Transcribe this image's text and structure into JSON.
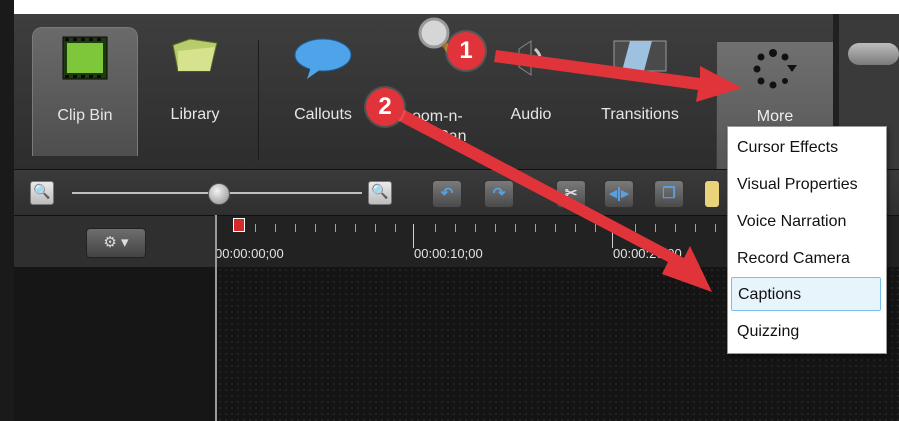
{
  "toolbar": {
    "tabs": [
      {
        "label": "Clip Bin",
        "icon": "film-strip-icon"
      },
      {
        "label": "Library",
        "icon": "folder-icon"
      },
      {
        "label": "Callouts",
        "icon": "speech-bubble-icon"
      },
      {
        "label": "Zoom-n-Pan",
        "icon": "magnifier-icon"
      },
      {
        "label": "Audio",
        "icon": "speaker-icon"
      },
      {
        "label": "Transitions",
        "icon": "transition-icon"
      }
    ],
    "more_label": "More",
    "more_icon": "loading-dots-icon",
    "zoom_label_visible_line1": "oom-n-",
    "zoom_label_visible_line2": "Pan"
  },
  "timeline": {
    "zoom_out_icon": "zoom-out-icon",
    "zoom_in_icon": "zoom-in-icon",
    "buttons": [
      "undo-icon",
      "redo-icon",
      "cut-icon",
      "split-icon",
      "copy-icon"
    ],
    "gear_label": "⚙ ▾",
    "times": [
      "00:00:00;00",
      "00:00:10;00",
      "00:00:20;00"
    ]
  },
  "menu": {
    "items": [
      "Cursor Effects",
      "Visual Properties",
      "Voice Narration",
      "Record Camera",
      "Captions",
      "Quizzing"
    ],
    "highlighted": "Captions"
  },
  "annotations": {
    "badge1": "1",
    "badge2": "2",
    "badge_color": "#e0343a"
  }
}
